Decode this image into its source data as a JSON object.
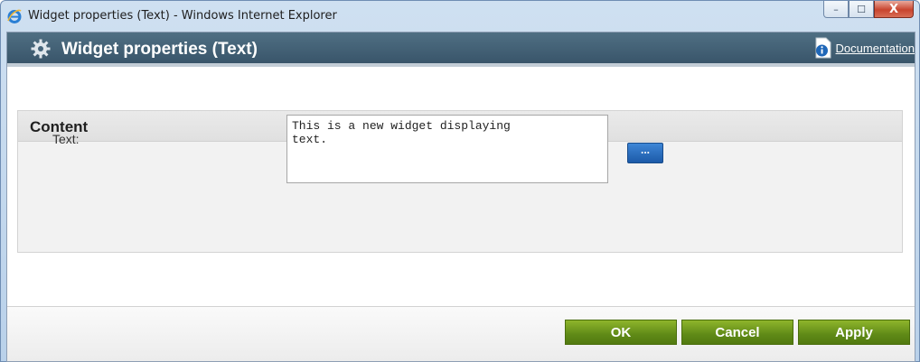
{
  "window": {
    "title": "Widget properties (Text) - Windows Internet Explorer",
    "controls": {
      "minimize": "–",
      "maximize": "☐",
      "close": "X"
    }
  },
  "header": {
    "title": "Widget properties (Text)",
    "doc_link": "Documentation",
    "icons": [
      "gear-icon",
      "info-icon"
    ]
  },
  "content": {
    "section_title": "Content",
    "text_field": {
      "label": "Text:",
      "value": "This is a new widget displaying\ntext."
    },
    "more_button_label": "..."
  },
  "footer": {
    "ok_label": "OK",
    "cancel_label": "Cancel",
    "apply_label": "Apply"
  },
  "colors": {
    "header_bg": "#45647a",
    "action_green": "#6f9a1e",
    "more_button_blue": "#2a6cc0"
  }
}
